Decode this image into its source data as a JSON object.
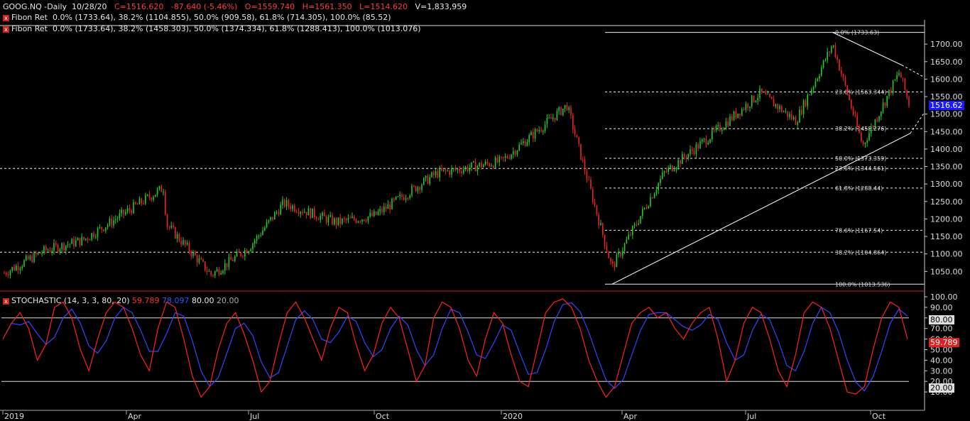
{
  "header": {
    "symbol": "GOOG.NQ -Daily",
    "date": "10/28/20",
    "close": "C=1516.620",
    "change": "-87.640 (-5.46%)",
    "open": "O=1559.740",
    "high": "H=1561.350",
    "low": "L=1514.620",
    "volume": "V=1,833,959"
  },
  "fib_lines": [
    {
      "label": "Fibon Ret",
      "values": "0.0% (1733.64), 38.2% (1104.855), 50.0% (909.58), 61.8% (714.305), 100.0% (85.52)"
    },
    {
      "label": "Fibon Ret",
      "values": "0.0% (1733.64), 38.2% (1458.303), 50.0% (1374.334), 61.8% (1288.413), 100.0% (1013.076)"
    }
  ],
  "last_price_label": "1516.62",
  "stoch_header": {
    "title": "STOCHASTIC (14, 3, 3, 80, 20)",
    "k_value": "59.789",
    "d_value": "78.097",
    "upper": "80.00",
    "lower": "20.00"
  },
  "stoch_labels": {
    "upper_box": "80.00",
    "k_box": "59.789",
    "lower_box": "20.00"
  },
  "colors": {
    "up": "#22cc22",
    "down": "#ee2222",
    "k_line": "#ff2020",
    "d_line": "#3344ff",
    "last_price_bg": "#1a1aff"
  },
  "chart_data": [
    {
      "type": "candlestick",
      "title": "GOOG.NQ -Daily",
      "x_ticks": [
        "2019",
        "Apr",
        "Jul",
        "Oct",
        "2020",
        "Apr",
        "Jul",
        "Oct"
      ],
      "y_ticks": [
        "1050.00",
        "1100.00",
        "1150.00",
        "1200.00",
        "1250.00",
        "1300.00",
        "1350.00",
        "1400.00",
        "1450.00",
        "1500.00",
        "1550.00",
        "1600.00",
        "1650.00",
        "1700.00"
      ],
      "ylim": [
        1010,
        1750
      ],
      "grid": false,
      "fib_levels": [
        {
          "label": "0.0% (1733.63)",
          "value": 1733.64
        },
        {
          "label": "23.6% (1563.344)",
          "value": 1563.344
        },
        {
          "label": "38.2% (1458.276)",
          "value": 1458.276
        },
        {
          "label": "50.0% (1373.359)",
          "value": 1373.359
        },
        {
          "label": "23.6% (1344.561)",
          "value": 1344.561
        },
        {
          "label": "61.8% (1288.44)",
          "value": 1288.44
        },
        {
          "label": "78.6% (1167.54)",
          "value": 1167.54
        },
        {
          "label": "38.2% (1104.864)",
          "value": 1104.864
        },
        {
          "label": "100.0% (1013.536)",
          "value": 1013.536
        }
      ],
      "trend_path": [
        {
          "t": "2019-01-02",
          "close": 1045
        },
        {
          "t": "2019-02-01",
          "close": 1110
        },
        {
          "t": "2019-03-01",
          "close": 1140
        },
        {
          "t": "2019-04-29",
          "close": 1290
        },
        {
          "t": "2019-05-01",
          "close": 1185
        },
        {
          "t": "2019-06-03",
          "close": 1040
        },
        {
          "t": "2019-07-01",
          "close": 1120
        },
        {
          "t": "2019-07-26",
          "close": 1245
        },
        {
          "t": "2019-09-03",
          "close": 1190
        },
        {
          "t": "2019-10-01",
          "close": 1210
        },
        {
          "t": "2019-11-15",
          "close": 1330
        },
        {
          "t": "2020-01-02",
          "close": 1365
        },
        {
          "t": "2020-02-19",
          "close": 1525
        },
        {
          "t": "2020-03-23",
          "close": 1060
        },
        {
          "t": "2020-04-30",
          "close": 1330
        },
        {
          "t": "2020-06-01",
          "close": 1430
        },
        {
          "t": "2020-07-10",
          "close": 1560
        },
        {
          "t": "2020-08-05",
          "close": 1480
        },
        {
          "t": "2020-09-01",
          "close": 1700
        },
        {
          "t": "2020-09-23",
          "close": 1410
        },
        {
          "t": "2020-10-20",
          "close": 1620
        },
        {
          "t": "2020-10-28",
          "close": 1516.62
        }
      ]
    },
    {
      "type": "line",
      "title": "STOCHASTIC (14, 3, 3, 80, 20)",
      "y_ticks": [
        "10.00",
        "20.00",
        "30.00",
        "40.00",
        "50.00",
        "60.00",
        "70.00",
        "80.00",
        "90.00",
        "100.00"
      ],
      "ylim": [
        0,
        100
      ],
      "series": [
        {
          "name": "59.789",
          "last": 59.789
        },
        {
          "name": "78.097",
          "last": 78.097
        }
      ],
      "levels": [
        80,
        20
      ],
      "path": [
        60,
        75,
        85,
        70,
        40,
        55,
        90,
        95,
        80,
        50,
        30,
        60,
        85,
        95,
        90,
        70,
        45,
        30,
        70,
        95,
        90,
        60,
        25,
        5,
        15,
        50,
        75,
        85,
        65,
        40,
        10,
        20,
        55,
        85,
        95,
        80,
        60,
        40,
        70,
        90,
        85,
        55,
        30,
        45,
        75,
        90,
        80,
        50,
        20,
        35,
        80,
        95,
        90,
        70,
        40,
        25,
        60,
        85,
        75,
        45,
        20,
        15,
        50,
        85,
        95,
        98,
        90,
        70,
        40,
        20,
        5,
        15,
        45,
        75,
        85,
        90,
        80,
        85,
        70,
        60,
        75,
        85,
        90,
        60,
        20,
        40,
        75,
        90,
        85,
        60,
        30,
        15,
        45,
        85,
        95,
        90,
        70,
        40,
        10,
        8,
        15,
        50,
        80,
        95,
        90,
        60
      ]
    }
  ]
}
